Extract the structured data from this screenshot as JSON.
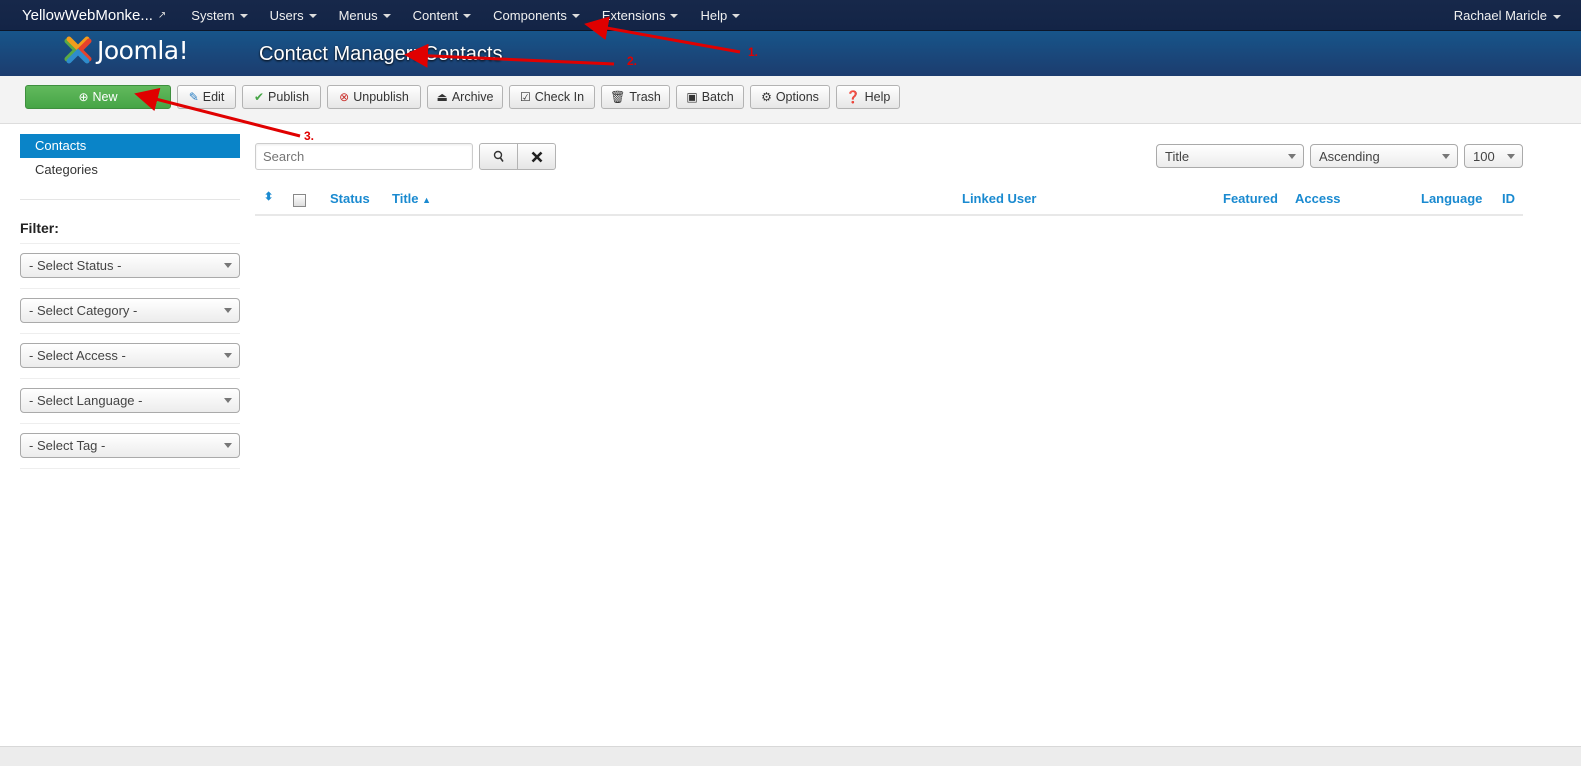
{
  "topnav": {
    "brand": "YellowWebMonke...",
    "menu": [
      {
        "label": "System"
      },
      {
        "label": "Users"
      },
      {
        "label": "Menus"
      },
      {
        "label": "Content"
      },
      {
        "label": "Components"
      },
      {
        "label": "Extensions"
      },
      {
        "label": "Help"
      }
    ],
    "user": "Rachael Maricle"
  },
  "header": {
    "logo_text": "Joomla!",
    "title": "Contact Manager: Contacts"
  },
  "toolbar": {
    "buttons": [
      {
        "label": "New",
        "icon": "plus-circle-icon"
      },
      {
        "label": "Edit",
        "icon": "edit-icon"
      },
      {
        "label": "Publish",
        "icon": "check-icon"
      },
      {
        "label": "Unpublish",
        "icon": "x-circle-icon"
      },
      {
        "label": "Archive",
        "icon": "archive-icon"
      },
      {
        "label": "Check In",
        "icon": "checkbox-icon"
      },
      {
        "label": "Trash",
        "icon": "trash-icon"
      },
      {
        "label": "Batch",
        "icon": "batch-icon"
      },
      {
        "label": "Options",
        "icon": "gear-icon"
      },
      {
        "label": "Help",
        "icon": "question-icon"
      }
    ],
    "colors": {
      "new_button": "#46a546"
    }
  },
  "sidebar": {
    "items": [
      {
        "label": "Contacts",
        "active": true
      },
      {
        "label": "Categories",
        "active": false
      }
    ],
    "filter_label": "Filter:",
    "filters": [
      {
        "value": "- Select Status -"
      },
      {
        "value": "- Select Category -"
      },
      {
        "value": "- Select Access -"
      },
      {
        "value": "- Select Language -"
      },
      {
        "value": "- Select Tag -"
      }
    ]
  },
  "main": {
    "search_placeholder": "Search",
    "sort_field": "Title",
    "sort_direction": "Ascending",
    "limit": "100",
    "columns": [
      "Status",
      "Title",
      "Linked User",
      "Featured",
      "Access",
      "Language",
      "ID"
    ],
    "rows": []
  },
  "annotations": [
    "1.",
    "2.",
    "3."
  ]
}
